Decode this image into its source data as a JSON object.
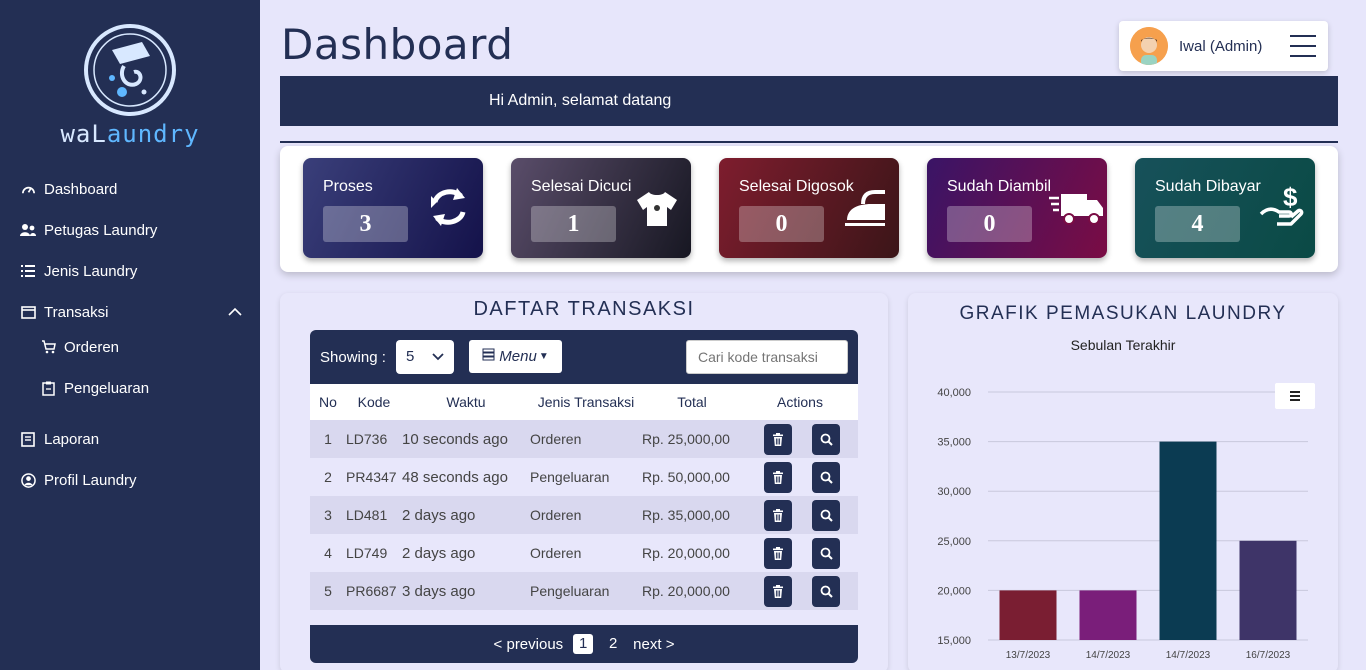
{
  "app": {
    "brand_part1": "waL",
    "brand_part2": "aundry"
  },
  "sidebar": {
    "items": [
      {
        "label": "Dashboard",
        "icon": "gauge-icon"
      },
      {
        "label": "Petugas Laundry",
        "icon": "users-icon"
      },
      {
        "label": "Jenis Laundry",
        "icon": "list-icon"
      },
      {
        "label": "Transaksi",
        "icon": "window-icon"
      },
      {
        "label": "Orderen",
        "icon": "cart-icon"
      },
      {
        "label": "Pengeluaran",
        "icon": "clipboard-icon"
      },
      {
        "label": "Laporan",
        "icon": "book-icon"
      },
      {
        "label": "Profil Laundry",
        "icon": "user-circle-icon"
      }
    ]
  },
  "header": {
    "title": "Dashboard",
    "user_name": "Iwal (Admin)"
  },
  "welcome": {
    "text": "Hi Admin, selamat datang"
  },
  "stats": [
    {
      "label": "Proses",
      "value": "3",
      "icon": "refresh-arrows-icon",
      "color_from": "#3a3f7a",
      "color_to": "#14124a"
    },
    {
      "label": "Selesai Dicuci",
      "value": "1",
      "icon": "tshirt-icon",
      "color_from": "#5a4d6a",
      "color_to": "#171722"
    },
    {
      "label": "Selesai Digosok",
      "value": "0",
      "icon": "iron-icon",
      "color_from": "#7e1d2e",
      "color_to": "#3b1518"
    },
    {
      "label": "Sudah Diambil",
      "value": "0",
      "icon": "truck-icon",
      "color_from": "#3a1466",
      "color_to": "#7a0c44"
    },
    {
      "label": "Sudah Dibayar",
      "value": "4",
      "icon": "hand-dollar-icon",
      "color_from": "#17515a",
      "color_to": "#0a4a45"
    }
  ],
  "transactions": {
    "title": "DAFTAR TRANSAKSI",
    "showing_label": "Showing :",
    "page_size": "5",
    "menu_label": "Menu",
    "search_placeholder": "Cari kode transaksi",
    "columns": [
      "No",
      "Kode",
      "Waktu",
      "Jenis Transaksi",
      "Total",
      "Actions"
    ],
    "rows": [
      {
        "no": "1",
        "kode": "LD736",
        "waktu": "10 seconds ago",
        "jenis": "Orderen",
        "total": "Rp. 25,000,00"
      },
      {
        "no": "2",
        "kode": "PR4347",
        "waktu": "48 seconds ago",
        "jenis": "Pengeluaran",
        "total": "Rp. 50,000,00"
      },
      {
        "no": "3",
        "kode": "LD481",
        "waktu": "2 days ago",
        "jenis": "Orderen",
        "total": "Rp. 35,000,00"
      },
      {
        "no": "4",
        "kode": "LD749",
        "waktu": "2 days ago",
        "jenis": "Orderen",
        "total": "Rp. 20,000,00"
      },
      {
        "no": "5",
        "kode": "PR6687",
        "waktu": "3 days ago",
        "jenis": "Pengeluaran",
        "total": "Rp. 20,000,00"
      }
    ],
    "pager": {
      "prev": "< previous",
      "pages": [
        "1",
        "2"
      ],
      "current": "1",
      "next": "next >"
    }
  },
  "chart": {
    "title": "GRAFIK PEMASUKAN LAUNDRY",
    "subtitle": "Sebulan Terakhir"
  },
  "chart_data": {
    "type": "bar",
    "categories": [
      "13/7/2023",
      "14/7/2023",
      "14/7/2023",
      "16/7/2023"
    ],
    "values": [
      20000,
      20000,
      35000,
      25000
    ],
    "colors": [
      "#7a1e32",
      "#7a1e7a",
      "#0b3b52",
      "#3e3468"
    ],
    "yticks": [
      "15,000",
      "20,000",
      "25,000",
      "30,000",
      "35,000",
      "40,000"
    ],
    "ylim": [
      15000,
      40000
    ],
    "grid": true
  }
}
